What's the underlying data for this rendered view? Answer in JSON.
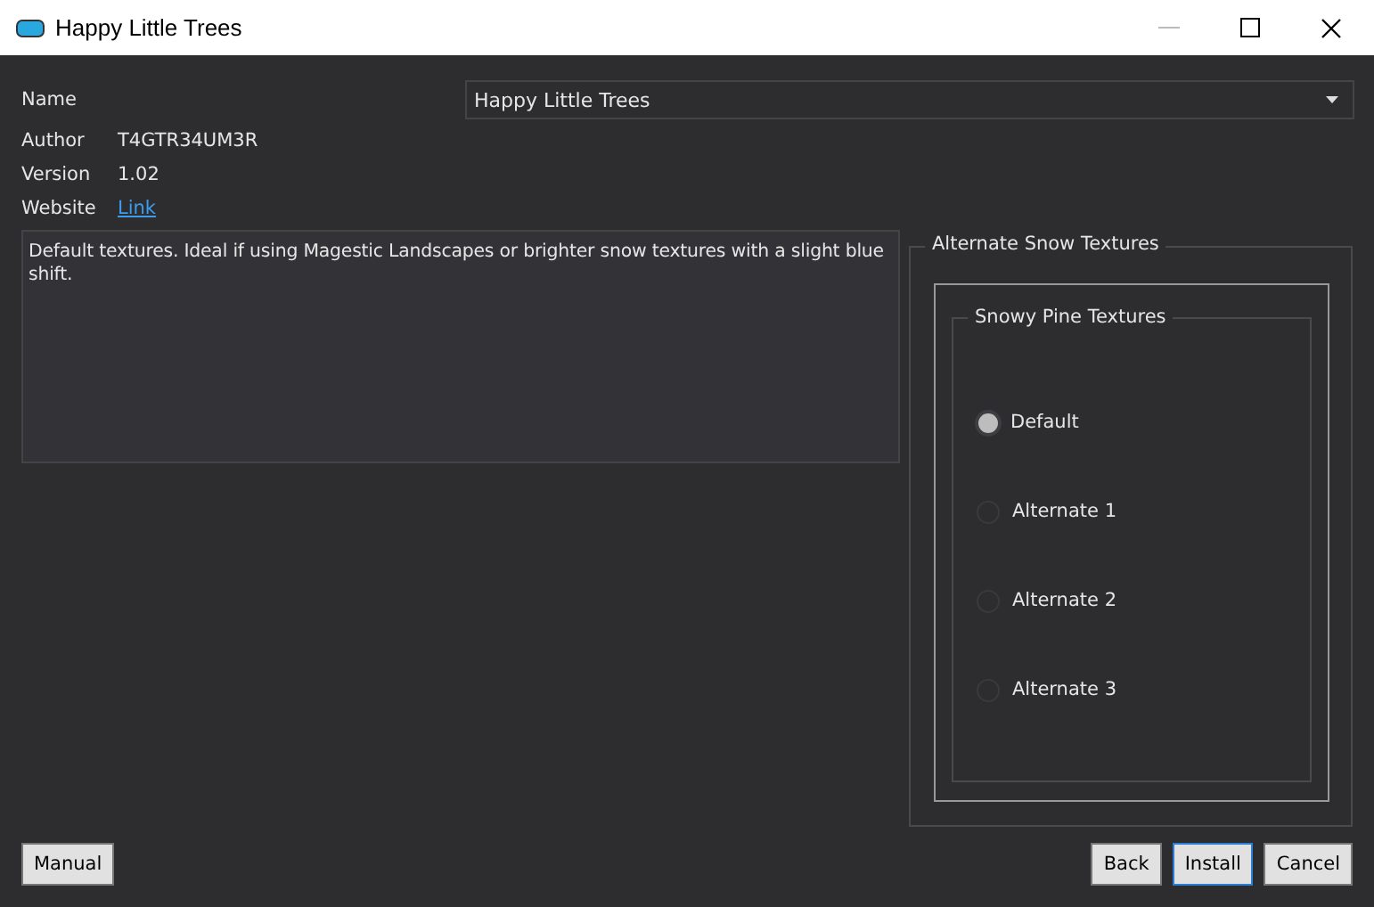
{
  "window": {
    "title": "Happy Little Trees"
  },
  "fields": [
    {
      "label": "Name",
      "kind": "dropdown",
      "value": "Happy Little Trees"
    },
    {
      "label": "Author",
      "kind": "text",
      "value": "T4GTR34UM3R"
    },
    {
      "label": "Version",
      "kind": "text",
      "value": "1.02"
    },
    {
      "label": "Website",
      "kind": "link",
      "value": "Link"
    }
  ],
  "description": "Default textures. Ideal if using Magestic Landscapes or brighter snow textures with a slight blue shift.",
  "options_group": {
    "title": "Alternate Snow Textures",
    "inner_title": "Snowy Pine Textures",
    "options": [
      {
        "label": "Default",
        "selected": true
      },
      {
        "label": "Alternate 1",
        "selected": false
      },
      {
        "label": "Alternate 2",
        "selected": false
      },
      {
        "label": "Alternate 3",
        "selected": false
      }
    ]
  },
  "left_buttons": [
    {
      "label": "Manual",
      "focused": false
    }
  ],
  "right_buttons": [
    {
      "label": "Back",
      "focused": false
    },
    {
      "label": "Install",
      "focused": true
    },
    {
      "label": "Cancel",
      "focused": false
    }
  ]
}
